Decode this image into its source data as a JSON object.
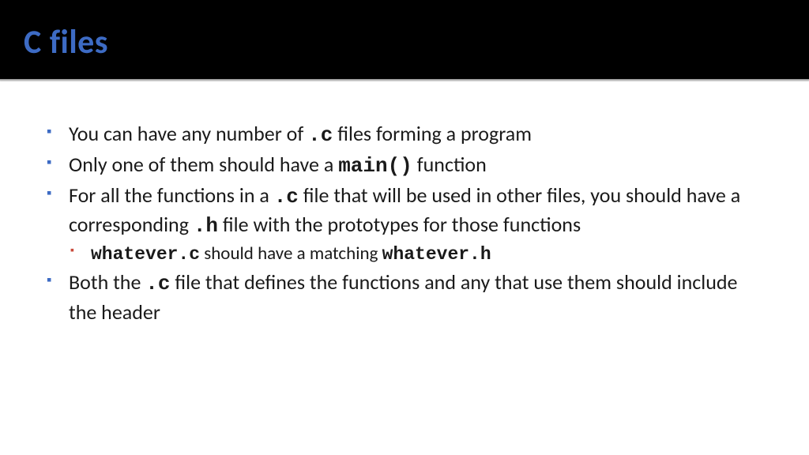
{
  "title": "C files",
  "bullets": {
    "b1": {
      "t1": "You can have any number of ",
      "c1": ".c",
      "t2": " files forming a program"
    },
    "b2": {
      "t1": "Only one of them should have a ",
      "c1": "main()",
      "t2": " function"
    },
    "b3": {
      "t1": "For all the functions in a ",
      "c1": ".c",
      "t2": " file that will be used in other files, you should have a corresponding ",
      "c2": ".h",
      "t3": " file with the prototypes for those functions"
    },
    "b3sub": {
      "c1": "whatever.c",
      "t1": " should have a matching ",
      "c2": "whatever.h"
    },
    "b4": {
      "t1": "Both the ",
      "c1": ".c",
      "t2": " file that defines the functions and any that use them should include the header"
    }
  }
}
